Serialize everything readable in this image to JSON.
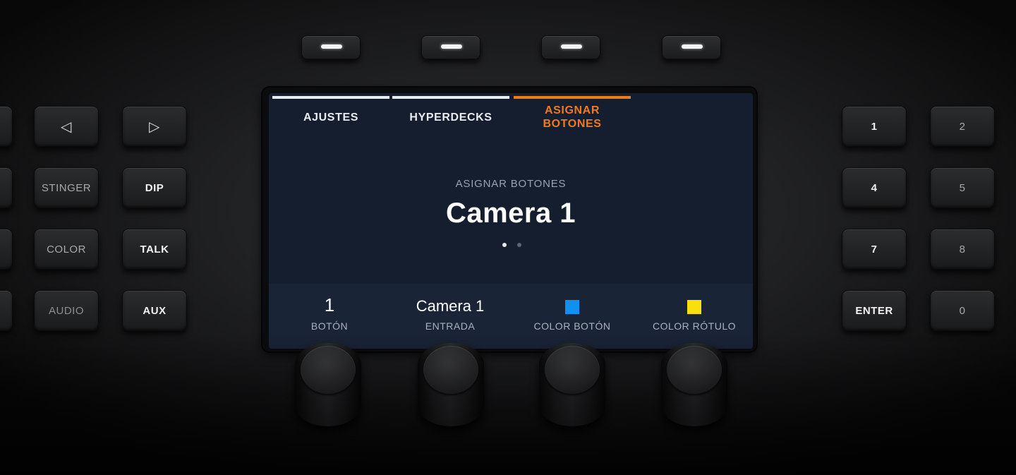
{
  "softkeys": [
    {
      "icon": "led-indicator"
    },
    {
      "icon": "led-indicator"
    },
    {
      "icon": "led-indicator"
    },
    {
      "icon": "led-indicator"
    }
  ],
  "left_keys": {
    "row1": {
      "left_icon": "◁",
      "right_icon": "▷"
    },
    "row2": {
      "left": "STINGER",
      "right": "DIP"
    },
    "row3": {
      "left": "COLOR",
      "right": "TALK"
    },
    "row4": {
      "left": "AUDIO",
      "right": "AUX"
    }
  },
  "right_keys": {
    "row1": {
      "left": "1",
      "right": "2"
    },
    "row2": {
      "left": "4",
      "right": "5"
    },
    "row3": {
      "left": "7",
      "right": "8"
    },
    "row4": {
      "left": "ENTER",
      "right": "0"
    }
  },
  "screen": {
    "tabs": [
      {
        "label": "AJUSTES"
      },
      {
        "label": "HYPERDECKS"
      },
      {
        "label": "ASIGNAR\nBOTONES",
        "line1": "ASIGNAR",
        "line2": "BOTONES",
        "active": true
      }
    ],
    "subtitle": "ASIGNAR BOTONES",
    "title": "Camera 1",
    "page_dots": {
      "count": 2,
      "active": 1
    },
    "params": [
      {
        "value": "1",
        "label": "BOTÓN"
      },
      {
        "value": "Camera 1",
        "label": "ENTRADA"
      },
      {
        "swatch_color": "#1090f0",
        "label": "COLOR BOTÓN"
      },
      {
        "swatch_color": "#f7e00e",
        "label": "COLOR RÓTULO"
      }
    ]
  },
  "colors": {
    "active_tab": "#f07a1a",
    "screen_bg": "#141e2f"
  }
}
